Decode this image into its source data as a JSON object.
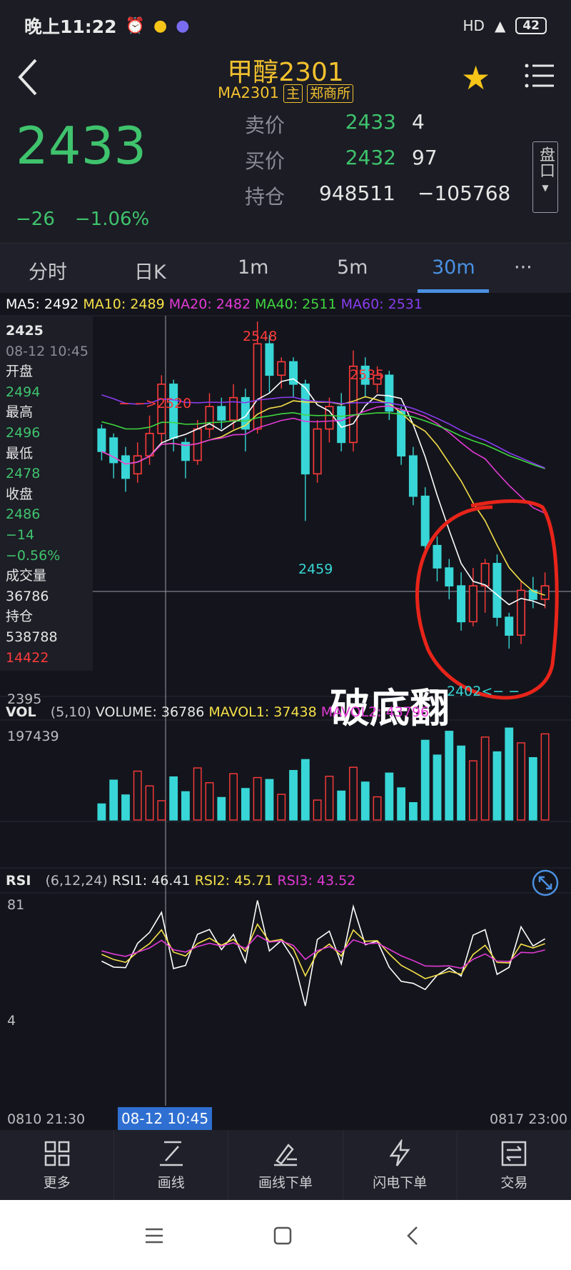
{
  "status_bar": {
    "time": "晚上11:22",
    "signal": "HD",
    "battery": "42"
  },
  "header": {
    "title": "甲醇2301",
    "code": "MA2301",
    "tag_main": "主",
    "tag_exchange": "郑商所"
  },
  "quote": {
    "last": "2433",
    "change": "−26",
    "change_pct": "−1.06%",
    "ask_label": "卖价",
    "ask_price": "2433",
    "ask_vol": "4",
    "bid_label": "买价",
    "bid_price": "2432",
    "bid_vol": "97",
    "oi_label": "持仓",
    "oi": "948511",
    "oi_change": "−105768",
    "pankou": "盘口"
  },
  "tabs": [
    "分时",
    "日K",
    "1m",
    "5m",
    "30m",
    "···"
  ],
  "active_tab": "30m",
  "ma_legend": {
    "ma5": "MA5: 2492",
    "ma10": "MA10: 2489",
    "ma20": "MA20: 2482",
    "ma40": "MA40: 2511",
    "ma60": "MA60: 2531",
    "colors": {
      "ma5": "#ffffff",
      "ma10": "#f5e04a",
      "ma20": "#e23ad6",
      "ma40": "#3fd63f",
      "ma60": "#8a3cf0"
    }
  },
  "info_panel": {
    "price": "2425",
    "datetime": "08-12 10:45",
    "open_label": "开盘",
    "open": "2494",
    "high_label": "最高",
    "high": "2496",
    "low_label": "最低",
    "low": "2478",
    "close_label": "收盘",
    "close": "2486",
    "chg": "−14",
    "chg_pct": "−0.56%",
    "vol_label": "成交量",
    "vol": "36786",
    "oi_label": "持仓",
    "oi": "538788",
    "oi_chg": "14422"
  },
  "price_chart": {
    "high_label": "2548",
    "high2_label": "2535",
    "low_label": "2459",
    "arrow_label": "− −>2520",
    "bottom_label": "2402<− −",
    "axis_min": "2395"
  },
  "annotation": "破底翻",
  "volume_panel": {
    "label": "VOL",
    "params": "(5,10)",
    "volume": "VOLUME: 36786",
    "mavol1": "MAVOL1: 37438",
    "mavol2": "MAVOL2: 43796",
    "axis_max": "197439"
  },
  "rsi_panel": {
    "label": "RSI",
    "params": "(6,12,24)",
    "rsi1": "RSI1: 46.41",
    "rsi2": "RSI2: 45.71",
    "rsi3": "RSI3: 43.52",
    "axis_top": "81",
    "axis_bottom": "4"
  },
  "dates": {
    "start": "0810 21:30",
    "cursor": "08-12 10:45",
    "end": "0817 23:00"
  },
  "toolbar": [
    "更多",
    "画线",
    "画线下单",
    "闪电下单",
    "交易"
  ],
  "chart_data": {
    "type": "candlestick",
    "y_range": [
      2395,
      2548
    ],
    "candles": [
      {
        "o": 2500,
        "c": 2490,
        "h": 2502,
        "l": 2486
      },
      {
        "o": 2496,
        "c": 2485,
        "h": 2498,
        "l": 2478
      },
      {
        "o": 2488,
        "c": 2478,
        "h": 2492,
        "l": 2472
      },
      {
        "o": 2480,
        "c": 2488,
        "h": 2494,
        "l": 2476
      },
      {
        "o": 2488,
        "c": 2498,
        "h": 2506,
        "l": 2484
      },
      {
        "o": 2498,
        "c": 2520,
        "h": 2524,
        "l": 2494
      },
      {
        "o": 2520,
        "c": 2496,
        "h": 2522,
        "l": 2490
      },
      {
        "o": 2494,
        "c": 2486,
        "h": 2496,
        "l": 2478
      },
      {
        "o": 2486,
        "c": 2500,
        "h": 2504,
        "l": 2484
      },
      {
        "o": 2500,
        "c": 2510,
        "h": 2516,
        "l": 2496
      },
      {
        "o": 2510,
        "c": 2504,
        "h": 2514,
        "l": 2500
      },
      {
        "o": 2504,
        "c": 2514,
        "h": 2520,
        "l": 2500
      },
      {
        "o": 2514,
        "c": 2500,
        "h": 2518,
        "l": 2490
      },
      {
        "o": 2500,
        "c": 2538,
        "h": 2548,
        "l": 2498
      },
      {
        "o": 2538,
        "c": 2524,
        "h": 2542,
        "l": 2516
      },
      {
        "o": 2524,
        "c": 2530,
        "h": 2532,
        "l": 2518
      },
      {
        "o": 2530,
        "c": 2520,
        "h": 2532,
        "l": 2514
      },
      {
        "o": 2520,
        "c": 2480,
        "h": 2522,
        "l": 2459
      },
      {
        "o": 2480,
        "c": 2500,
        "h": 2504,
        "l": 2476
      },
      {
        "o": 2500,
        "c": 2510,
        "h": 2514,
        "l": 2494
      },
      {
        "o": 2510,
        "c": 2494,
        "h": 2516,
        "l": 2490
      },
      {
        "o": 2494,
        "c": 2528,
        "h": 2535,
        "l": 2490
      },
      {
        "o": 2528,
        "c": 2520,
        "h": 2532,
        "l": 2514
      },
      {
        "o": 2520,
        "c": 2524,
        "h": 2528,
        "l": 2516
      },
      {
        "o": 2524,
        "c": 2508,
        "h": 2526,
        "l": 2504
      },
      {
        "o": 2508,
        "c": 2488,
        "h": 2510,
        "l": 2484
      },
      {
        "o": 2488,
        "c": 2470,
        "h": 2492,
        "l": 2466
      },
      {
        "o": 2470,
        "c": 2448,
        "h": 2474,
        "l": 2444
      },
      {
        "o": 2448,
        "c": 2438,
        "h": 2452,
        "l": 2432
      },
      {
        "o": 2438,
        "c": 2430,
        "h": 2442,
        "l": 2424
      },
      {
        "o": 2430,
        "c": 2414,
        "h": 2436,
        "l": 2410
      },
      {
        "o": 2414,
        "c": 2430,
        "h": 2438,
        "l": 2412
      },
      {
        "o": 2430,
        "c": 2440,
        "h": 2442,
        "l": 2418
      },
      {
        "o": 2440,
        "c": 2416,
        "h": 2444,
        "l": 2412
      },
      {
        "o": 2416,
        "c": 2408,
        "h": 2418,
        "l": 2402
      },
      {
        "o": 2408,
        "c": 2428,
        "h": 2432,
        "l": 2404
      },
      {
        "o": 2428,
        "c": 2424,
        "h": 2434,
        "l": 2420
      },
      {
        "o": 2424,
        "c": 2430,
        "h": 2436,
        "l": 2420
      }
    ]
  }
}
